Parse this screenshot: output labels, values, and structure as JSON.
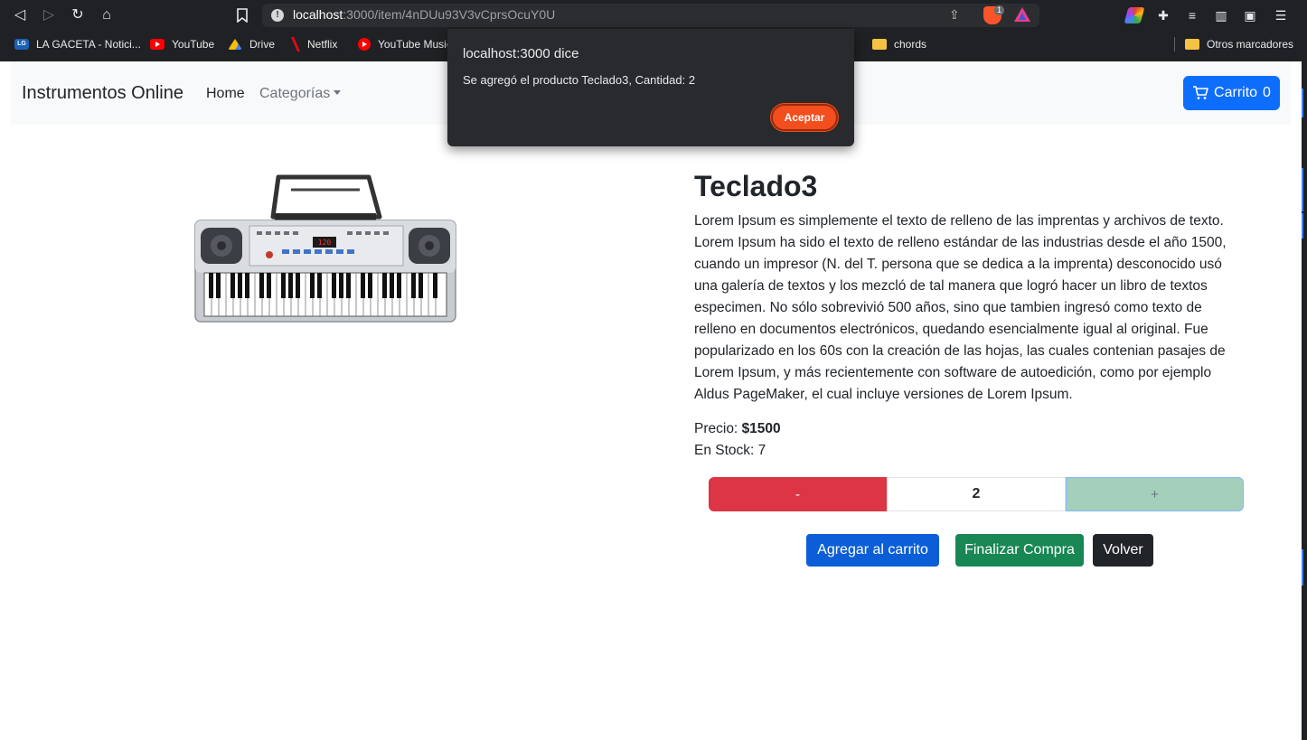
{
  "browser": {
    "url_host": "localhost",
    "url_rest": ":3000/item/4nDUu93V3vCprsOcuY0U",
    "brave_badge": "1",
    "bookmarks": [
      {
        "label": "LA GACETA - Notici...",
        "icon": "lagaceta-icon"
      },
      {
        "label": "YouTube",
        "icon": "youtube-icon"
      },
      {
        "label": "Drive",
        "icon": "drive-icon"
      },
      {
        "label": "Netflix",
        "icon": "netflix-icon"
      },
      {
        "label": "YouTube Music",
        "icon": "youtube-music-icon"
      },
      {
        "label": "chords",
        "icon": "folder-icon"
      },
      {
        "label": "Otros marcadores",
        "icon": "folder-icon"
      }
    ]
  },
  "navbar": {
    "brand": "Instrumentos Online",
    "home": "Home",
    "categories": "Categorías",
    "cart_label": "Carrito",
    "cart_count": "0"
  },
  "product": {
    "title": "Teclado3",
    "description": "Lorem Ipsum es simplemente el texto de relleno de las imprentas y archivos de texto. Lorem Ipsum ha sido el texto de relleno estándar de las industrias desde el año 1500, cuando un impresor (N. del T. persona que se dedica a la imprenta) desconocido usó una galería de textos y los mezcló de tal manera que logró hacer un libro de textos especimen. No sólo sobrevivió 500 años, sino que tambien ingresó como texto de relleno en documentos electrónicos, quedando esencialmente igual al original. Fue popularizado en los 60s con la creación de las hojas, las cuales contenian pasajes de Lorem Ipsum, y más recientemente con software de autoedición, como por ejemplo Aldus PageMaker, el cual incluye versiones de Lorem Ipsum.",
    "price_label": "Precio:",
    "price_value": "$1500",
    "stock_text": "En Stock: 7",
    "keyboard_display": "120"
  },
  "quantity": {
    "minus": "-",
    "value": "2",
    "plus": "+"
  },
  "actions": {
    "add": "Agregar al carrito",
    "finish": "Finalizar Compra",
    "back": "Volver"
  },
  "alert": {
    "title": "localhost:3000 dice",
    "message": "Se agregó el producto Teclado3, Cantidad: 2",
    "ok": "Aceptar"
  },
  "colors": {
    "primary": "#0d6efd",
    "danger": "#dc3545",
    "success": "#198754",
    "dark": "#212529",
    "alert_accent": "#f24e1e"
  }
}
